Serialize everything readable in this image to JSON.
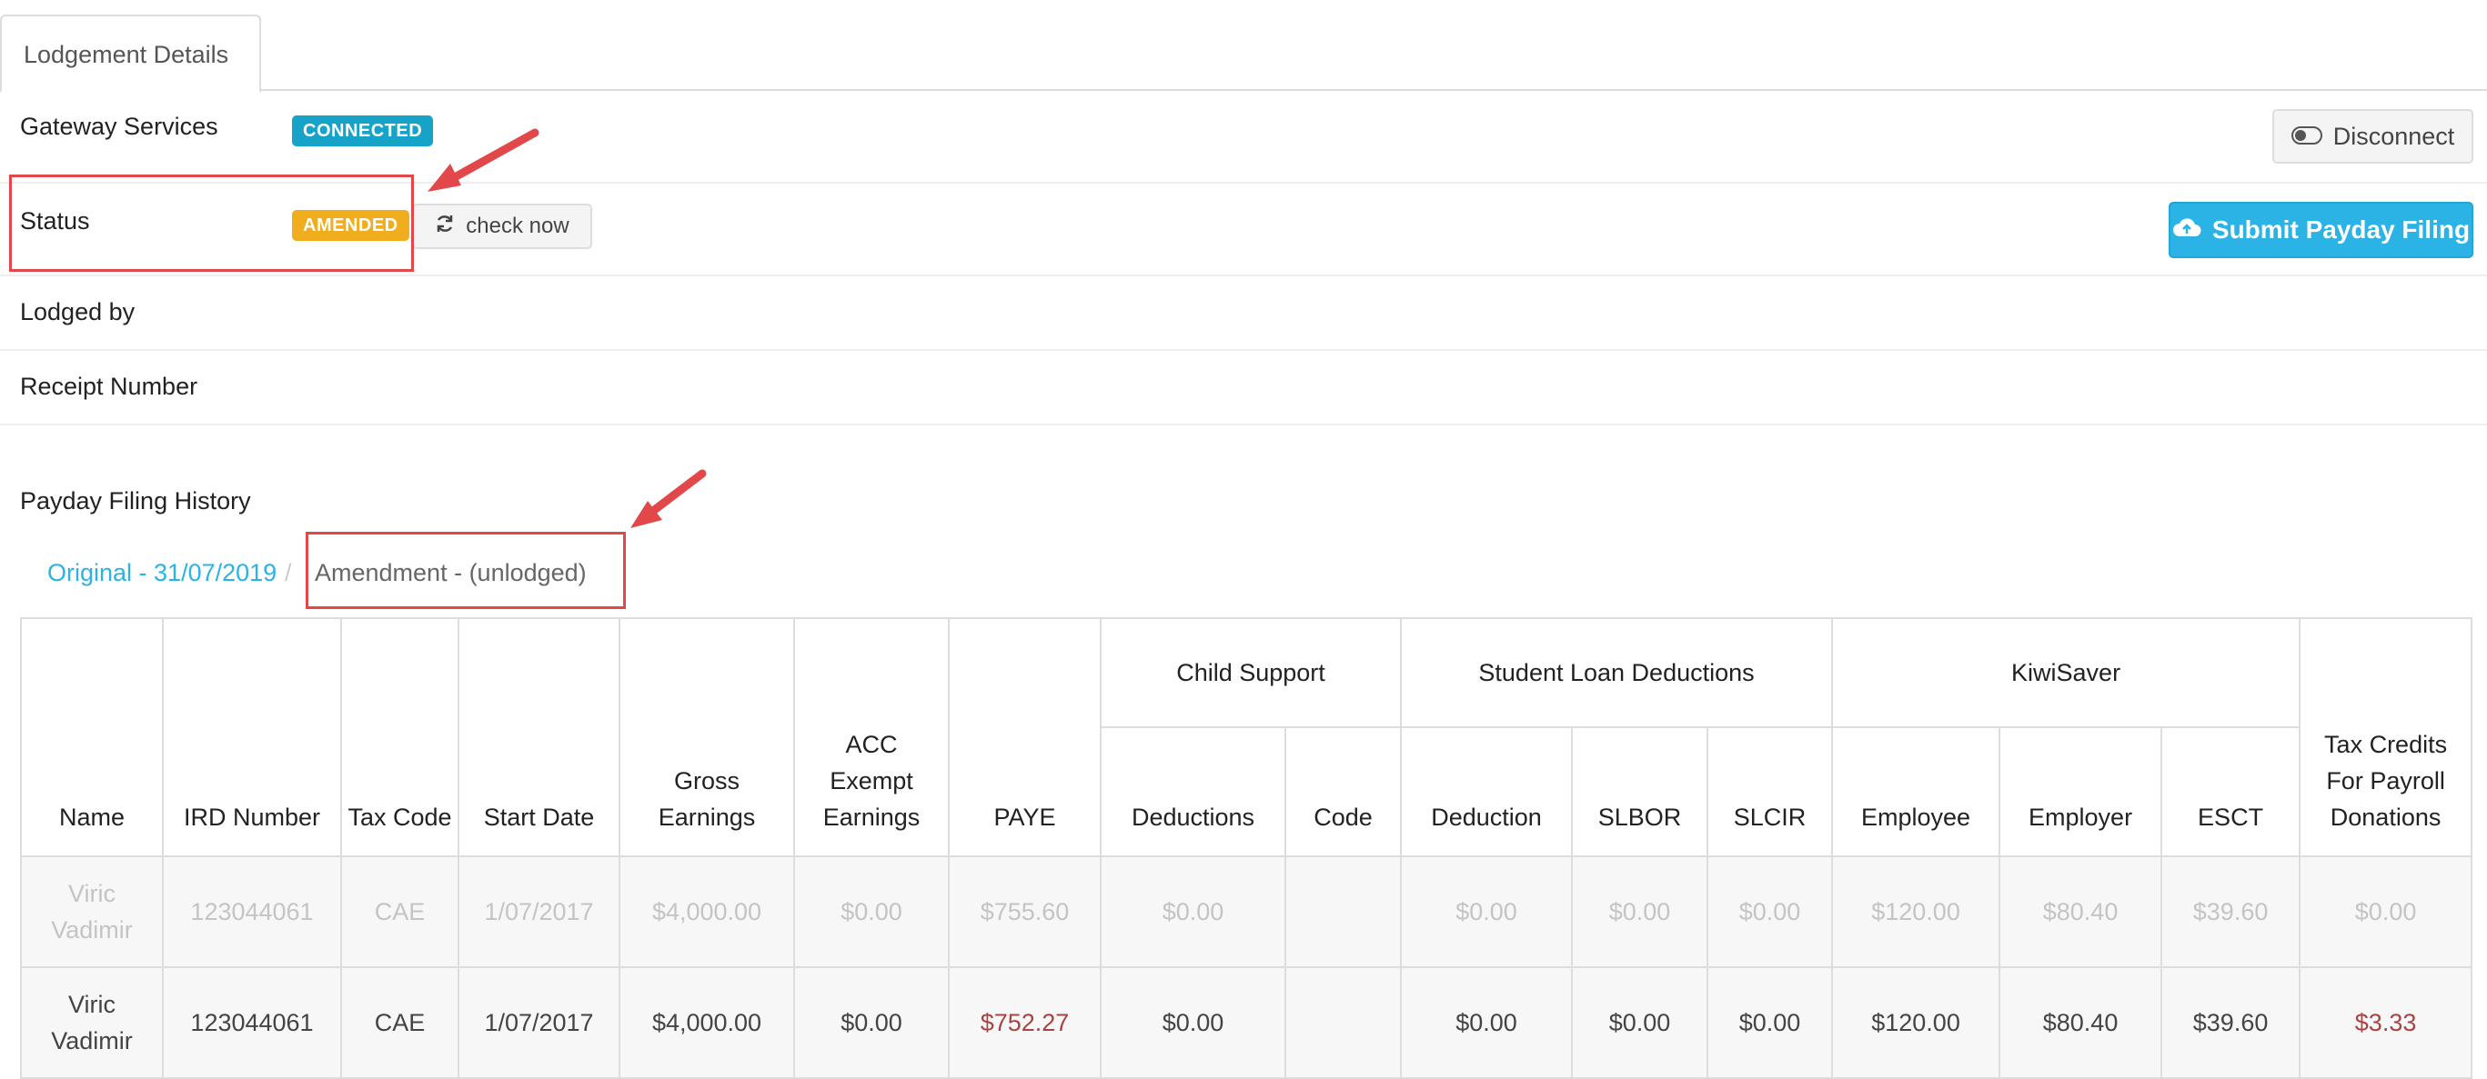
{
  "tab": {
    "label": "Lodgement Details"
  },
  "gateway": {
    "label": "Gateway Services",
    "badge": "CONNECTED",
    "disconnect_label": "Disconnect"
  },
  "status": {
    "label": "Status",
    "badge": "AMENDED",
    "check_label": "check now",
    "submit_label": "Submit Payday Filing"
  },
  "lodged_by": {
    "label": "Lodged by"
  },
  "receipt": {
    "label": "Receipt Number"
  },
  "history": {
    "title": "Payday Filing History",
    "breadcrumb": {
      "original": "Original - 31/07/2019",
      "separator": "/",
      "amendment": "Amendment - (unlodged)"
    }
  },
  "table": {
    "groups": {
      "child_support": "Child Support",
      "student_loan": "Student Loan Deductions",
      "kiwisaver": "KiwiSaver"
    },
    "headers": {
      "name": "Name",
      "ird": "IRD Number",
      "tax_code": "Tax Code",
      "start_date": "Start Date",
      "gross": "Gross Earnings",
      "acc": "ACC Exempt Earnings",
      "paye": "PAYE",
      "cs_deductions": "Deductions",
      "cs_code": "Code",
      "sl_deduction": "Deduction",
      "slbor": "SLBOR",
      "slcir": "SLCIR",
      "employee": "Employee",
      "employer": "Employer",
      "esct": "ESCT",
      "tax_credits": "Tax Credits For Payroll Donations"
    },
    "rows": [
      {
        "name": "Viric Vadimir",
        "ird": "123044061",
        "tax_code": "CAE",
        "start_date": "1/07/2017",
        "gross": "$4,000.00",
        "acc": "$0.00",
        "paye": "$755.60",
        "cs_deductions": "$0.00",
        "cs_code": "",
        "sl_deduction": "$0.00",
        "slbor": "$0.00",
        "slcir": "$0.00",
        "employee": "$120.00",
        "employer": "$80.40",
        "esct": "$39.60",
        "tax_credits": "$0.00"
      },
      {
        "name": "Viric Vadimir",
        "ird": "123044061",
        "tax_code": "CAE",
        "start_date": "1/07/2017",
        "gross": "$4,000.00",
        "acc": "$0.00",
        "paye": "$752.27",
        "cs_deductions": "$0.00",
        "cs_code": "",
        "sl_deduction": "$0.00",
        "slbor": "$0.00",
        "slcir": "$0.00",
        "employee": "$120.00",
        "employer": "$80.40",
        "esct": "$39.60",
        "tax_credits": "$3.33"
      }
    ]
  },
  "colors": {
    "info": "#17a2c8",
    "warning": "#f0ad1e",
    "primary": "#2ab3e4",
    "link": "#2ab3e4",
    "changed": "#a94442",
    "annotation": "#e2474a"
  }
}
